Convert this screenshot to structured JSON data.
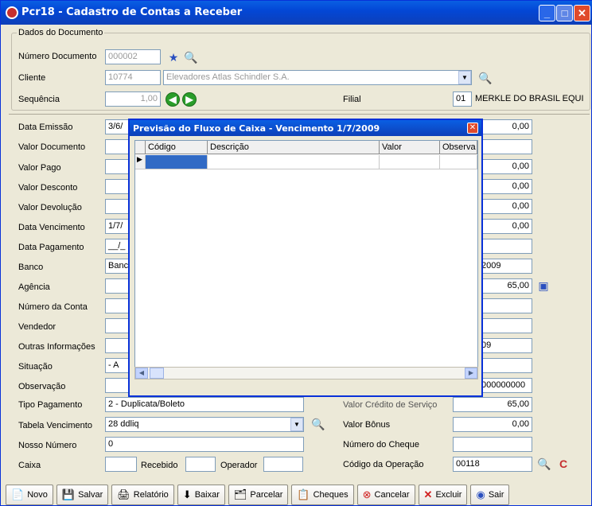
{
  "window": {
    "title": "Pcr18 - Cadastro de Contas a Receber"
  },
  "dados": {
    "group_title": "Dados do Documento",
    "numero_label": "Número Documento",
    "numero_value": "000002",
    "cliente_label": "Cliente",
    "cliente_code": "10774",
    "cliente_name": "Elevadores Atlas Schindler S.A.",
    "sequencia_label": "Sequência",
    "sequencia_value": "1,00",
    "filial_label": "Filial",
    "filial_code": "01",
    "filial_name": "MERKLE DO BRASIL EQUI"
  },
  "left_labels": [
    "Data Emissão",
    "Valor Documento",
    "Valor Pago",
    "Valor Desconto",
    "Valor Devolução",
    "Data Vencimento",
    "Data Pagamento",
    "Banco",
    "Agência",
    "Número da Conta",
    "Vendedor",
    "Outras Informações",
    "Situação",
    "Observação",
    "Tipo Pagamento",
    "Tabela Vencimento",
    "Nosso Número",
    "Caixa"
  ],
  "left_values": {
    "data_emissao": "3/6/",
    "data_vencimento": "1/7/",
    "data_pagamento": "__/_",
    "banco": "Banc",
    "situacao": "- A",
    "tipo_pagamento": "2 - Duplicata/Boleto",
    "tabela_vencimento": "28 ddliq",
    "nosso_numero": "0"
  },
  "caixa": {
    "recebido_label": "Recebido",
    "operador_label": "Operador"
  },
  "right_values": {
    "v1": "0,00",
    "v2": "0,00",
    "v3": "0,00",
    "v4": "0,00",
    "v5": "0,00",
    "date": "2009",
    "amount": "65,00",
    "date2": "09",
    "long": "000000000",
    "valor_servico": "65,00"
  },
  "right_labels": {
    "valor_servico": "Valor Crédito de Serviço",
    "bonus": "Valor Bônus",
    "bonus_value": "0,00",
    "cheque": "Número do Cheque",
    "operacao": "Código da Operação",
    "operacao_value": "00118"
  },
  "dialog": {
    "title": "Previsão do Fluxo de Caixa  - Vencimento 1/7/2009",
    "columns": [
      "Código",
      "Descrição",
      "Valor",
      "Observa"
    ]
  },
  "toolbar": {
    "novo": "Novo",
    "salvar": "Salvar",
    "relatorio": "Relatório",
    "baixar": "Baixar",
    "parcelar": "Parcelar",
    "cheques": "Cheques",
    "cancelar": "Cancelar",
    "excluir": "Excluir",
    "sair": "Sair"
  },
  "colors": {
    "titlebar": "#0347d6",
    "background": "#ece9d8"
  }
}
